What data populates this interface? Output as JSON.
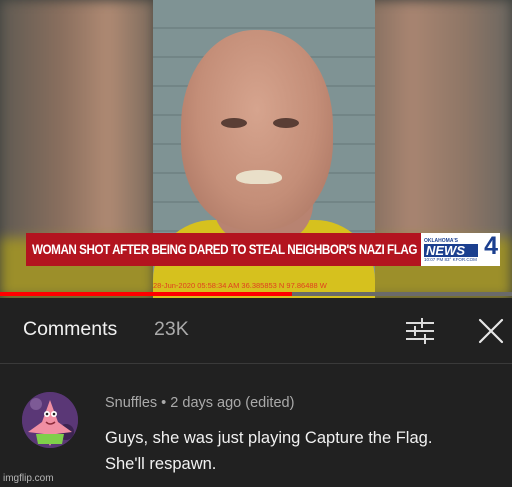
{
  "video": {
    "headline": "WOMAN SHOT AFTER BEING DARED TO STEAL NEIGHBOR'S NAZI FLAG",
    "logo": {
      "top_text": "OKLAHOMA'S",
      "news": "NEWS",
      "channel": "4",
      "info": "10:07 PM  83° KFOR.COM"
    },
    "ticker": "28-Jun-2020 05:58:34 AM  36.385853 N 97.86488 W",
    "progress": 0.57,
    "accent_color": "#ff0000",
    "banner_color": "#b3141f"
  },
  "comments_header": {
    "title": "Comments",
    "count": "23K",
    "filter_icon": "sort-filter-icon",
    "close_icon": "close-icon"
  },
  "comment": {
    "author": "Snuffles",
    "time": "2 days ago (edited)",
    "separator": "•",
    "lines": [
      "Guys, she was just playing Capture the Flag.",
      "She'll respawn."
    ]
  },
  "watermark": "imgflip.com"
}
